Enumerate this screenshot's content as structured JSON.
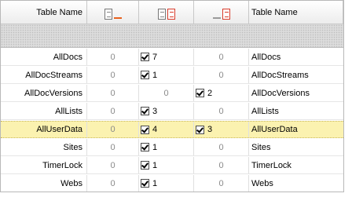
{
  "columns": {
    "left_header": "Table Name",
    "right_header": "Table Name",
    "col2_icon": "document-with-orange-underline-icon",
    "col3_icon": "two-documents-icon",
    "col4_icon": "document-with-gray-underline-icon"
  },
  "colors": {
    "selected_row": "#fbf2b0",
    "accent_red": "#d93b2b",
    "accent_orange": "#e8601c"
  },
  "rows": [
    {
      "name": "AllDocs",
      "v1": "0",
      "v2": "7",
      "v2_checked": true,
      "v3": "0",
      "v3_checked": false,
      "name2": "AllDocs",
      "selected": false
    },
    {
      "name": "AllDocStreams",
      "v1": "0",
      "v2": "1",
      "v2_checked": true,
      "v3": "0",
      "v3_checked": false,
      "name2": "AllDocStreams",
      "selected": false
    },
    {
      "name": "AllDocVersions",
      "v1": "0",
      "v2": "0",
      "v2_checked": false,
      "v3": "2",
      "v3_checked": true,
      "name2": "AllDocVersions",
      "selected": false
    },
    {
      "name": "AllLists",
      "v1": "0",
      "v2": "3",
      "v2_checked": true,
      "v3": "0",
      "v3_checked": false,
      "name2": "AllLists",
      "selected": false
    },
    {
      "name": "AllUserData",
      "v1": "0",
      "v2": "4",
      "v2_checked": true,
      "v3": "3",
      "v3_checked": true,
      "name2": "AllUserData",
      "selected": true
    },
    {
      "name": "Sites",
      "v1": "0",
      "v2": "1",
      "v2_checked": true,
      "v3": "0",
      "v3_checked": false,
      "name2": "Sites",
      "selected": false
    },
    {
      "name": "TimerLock",
      "v1": "0",
      "v2": "1",
      "v2_checked": true,
      "v3": "0",
      "v3_checked": false,
      "name2": "TimerLock",
      "selected": false
    },
    {
      "name": "Webs",
      "v1": "0",
      "v2": "1",
      "v2_checked": true,
      "v3": "0",
      "v3_checked": false,
      "name2": "Webs",
      "selected": false
    }
  ]
}
